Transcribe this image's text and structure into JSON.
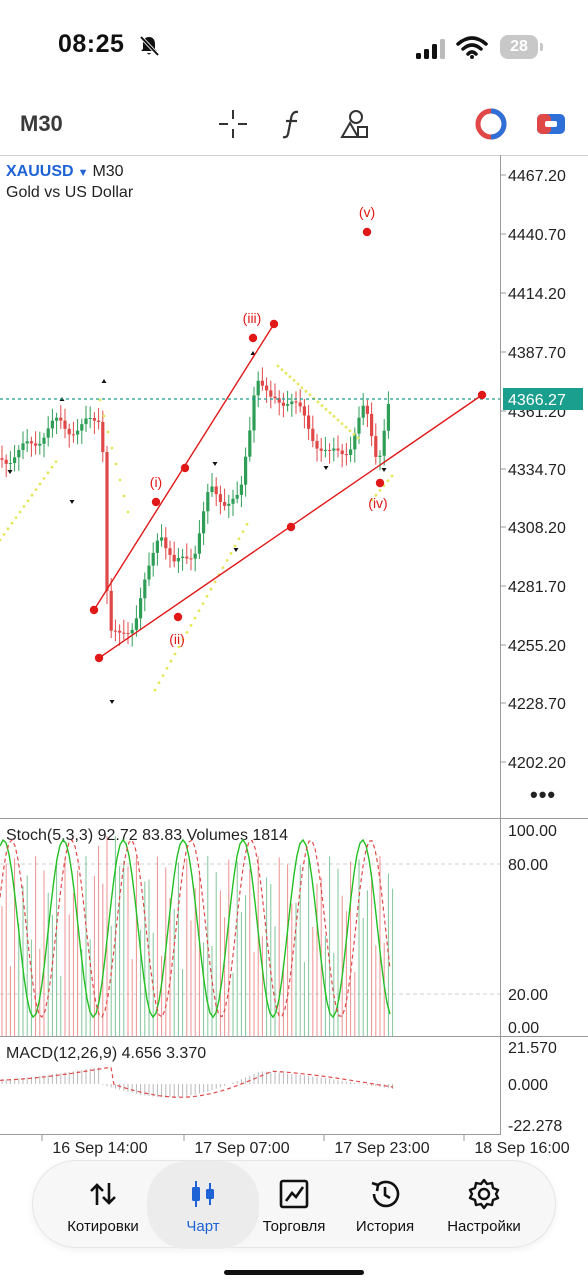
{
  "status_bar": {
    "time": "08:25",
    "battery": "28"
  },
  "toolbar": {
    "timeframe": "M30",
    "icons": [
      "crosshair-icon",
      "indicator-function-icon",
      "drawing-objects-icon",
      "one-click-trading-icon",
      "trade-icon"
    ]
  },
  "chart": {
    "symbol": "XAUUSD",
    "timeframe": "M30",
    "description": "Gold vs US Dollar",
    "current_price": "4366.27",
    "price_axis": [
      "4467.20",
      "4440.70",
      "4414.20",
      "4387.70",
      "4361.20",
      "4334.70",
      "4308.20",
      "4281.70",
      "4255.20",
      "4228.70",
      "4202.20"
    ],
    "time_axis": [
      "16 Sep 14:00",
      "17 Sep 07:00",
      "17 Sep 23:00",
      "18 Sep 16:00"
    ],
    "wave_labels": [
      "(i)",
      "(ii)",
      "(iii)",
      "(iv)",
      "(v)"
    ],
    "stoch": {
      "label": "Stoch(5,3,3) 92.72 83.83 Volumes 1814",
      "levels": [
        "100.00",
        "80.00",
        "20.00",
        "0.00"
      ]
    },
    "macd": {
      "label": "MACD(12,26,9) 4.656 3.370",
      "levels": [
        "21.570",
        "0.000",
        "-22.278"
      ]
    },
    "colors": {
      "up": "#2e9e57",
      "down": "#e04848",
      "psar": "#e6e65a",
      "annotation": "#e01818",
      "price_line": "#1a9e8e",
      "stoch_main": "#22c022",
      "symbol": "#1e63d6"
    }
  },
  "bottom_nav": {
    "items": [
      {
        "label": "Котировки",
        "icon": "quotes-arrows-icon"
      },
      {
        "label": "Чарт",
        "icon": "chart-candles-icon",
        "active": true
      },
      {
        "label": "Торговля",
        "icon": "trade-chart-icon"
      },
      {
        "label": "История",
        "icon": "history-clock-icon"
      },
      {
        "label": "Настройки",
        "icon": "settings-gear-icon"
      }
    ]
  }
}
